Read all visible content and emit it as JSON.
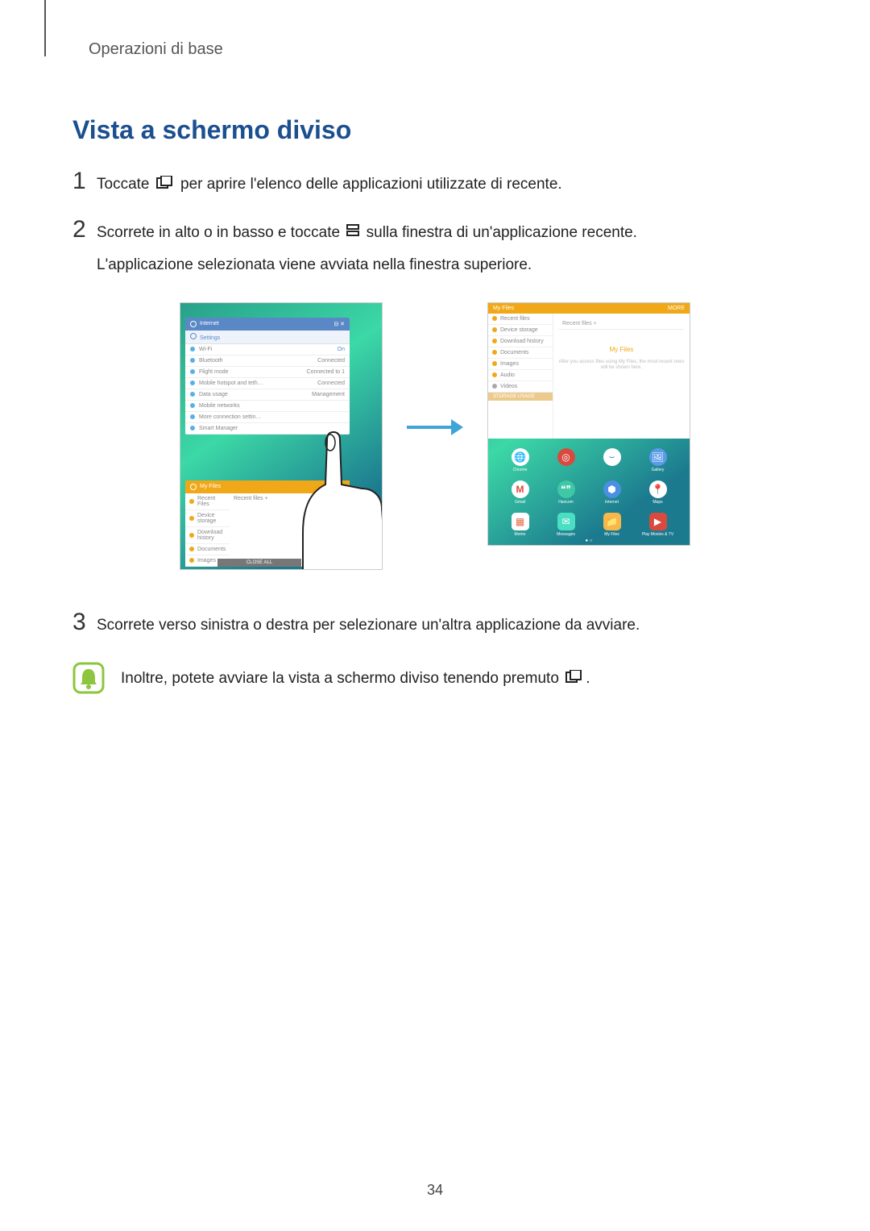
{
  "section_label": "Operazioni di base",
  "heading": "Vista a schermo diviso",
  "steps": {
    "1": {
      "num": "1",
      "before": "Toccate ",
      "after": " per aprire l'elenco delle applicazioni utilizzate di recente."
    },
    "2": {
      "num": "2",
      "line1_before": "Scorrete in alto o in basso e toccate ",
      "line1_after": " sulla finestra di un'applicazione recente.",
      "line2": "L'applicazione selezionata viene avviata nella finestra superiore."
    },
    "3": {
      "num": "3",
      "text": "Scorrete verso sinistra o destra per selezionare un'altra applicazione da avviare."
    }
  },
  "note": {
    "before": "Inoltre, potete avviare la vista a schermo diviso tenendo premuto ",
    "after": "."
  },
  "page_number": "34",
  "left_screen": {
    "settings": {
      "header": "Internet",
      "header_icons": "⊟  ✕",
      "sub": "Settings",
      "items": [
        {
          "dot": "#58b0e8",
          "label": "Wi-Fi",
          "right": "On"
        },
        {
          "dot": "#58b0e8",
          "label": "Bluetooth",
          "right": "Connected"
        },
        {
          "dot": "#58b0e8",
          "label": "Flight mode",
          "right": "Connected to 1"
        },
        {
          "dot": "#58b0e8",
          "label": "Mobile hotspot and teth…",
          "right": "Connected"
        },
        {
          "dot": "#58b0e8",
          "label": "Data usage",
          "right": "Management"
        },
        {
          "dot": "#58b0e8",
          "label": "Mobile networks",
          "right": ""
        },
        {
          "dot": "#58b0e8",
          "label": "More connection settin…",
          "right": ""
        },
        {
          "dot": "#58b0e8",
          "label": "Smart Manager",
          "right": ""
        }
      ]
    },
    "files": {
      "header": "My Files",
      "header_x": "✕",
      "tab1": "Recent Files",
      "tab2": "Recent files   +",
      "items": [
        {
          "dot": "#f0a818",
          "label": "Device storage"
        },
        {
          "dot": "#f0a818",
          "label": "Download history"
        },
        {
          "dot": "#f0a818",
          "label": "Documents"
        },
        {
          "dot": "#f0a818",
          "label": "Images"
        }
      ],
      "close": "CLOSE ALL"
    }
  },
  "right_screen": {
    "header": "My Files",
    "header_right": "MORE",
    "tabs": "Recent files   +",
    "nav": [
      {
        "dot": "#f0a818",
        "label": "Recent files"
      },
      {
        "dot": "#f0a818",
        "label": "Device storage"
      },
      {
        "dot": "#f0a818",
        "label": "Download history"
      },
      {
        "dot": "#f0a818",
        "label": "Documents"
      },
      {
        "dot": "#f0a818",
        "label": "Images"
      },
      {
        "dot": "#f0a818",
        "label": "Audio"
      },
      {
        "dot": "#a8a8a8",
        "label": "Videos"
      }
    ],
    "main_title": "My Files",
    "main_desc": "After you access files using My Files, the most recent ones will be shown here.",
    "storage": "STORAGE USAGE",
    "apps": [
      {
        "bg": "#ffffff",
        "glyph": "🌐",
        "label": "Chrome",
        "tc": "#d94a3e"
      },
      {
        "bg": "#d94a3e",
        "glyph": "◎",
        "label": "",
        "tc": "#fff"
      },
      {
        "bg": "#ffffff",
        "glyph": "⌣",
        "label": "",
        "tc": "#4a90e2"
      },
      {
        "bg": "#5a9be8",
        "glyph": "🖼",
        "label": "Gallery",
        "tc": "#fff"
      },
      {
        "bg": "#ffffff",
        "glyph": "M",
        "label": "Gmail",
        "tc": "#d94a3e"
      },
      {
        "bg": "#3fc7a6",
        "glyph": "❝❞",
        "label": "Hancom",
        "tc": "#fff"
      },
      {
        "bg": "#4a90e2",
        "glyph": "⬢",
        "label": "Internet",
        "tc": "#fff"
      },
      {
        "bg": "#ffffff",
        "glyph": "📍",
        "label": "Maps",
        "tc": "#d94a3e"
      },
      {
        "bg": "#ffffff",
        "glyph": "▦",
        "label": "Memo",
        "tc": "#e86a4a",
        "shape": "square"
      },
      {
        "bg": "#4adfc3",
        "glyph": "✉",
        "label": "Messages",
        "tc": "#fff",
        "shape": "square"
      },
      {
        "bg": "#f6b84a",
        "glyph": "📁",
        "label": "My Files",
        "tc": "#fff",
        "shape": "square"
      },
      {
        "bg": "#d94a3e",
        "glyph": "▶",
        "label": "Play Movies & TV",
        "tc": "#fff",
        "shape": "square"
      }
    ]
  }
}
